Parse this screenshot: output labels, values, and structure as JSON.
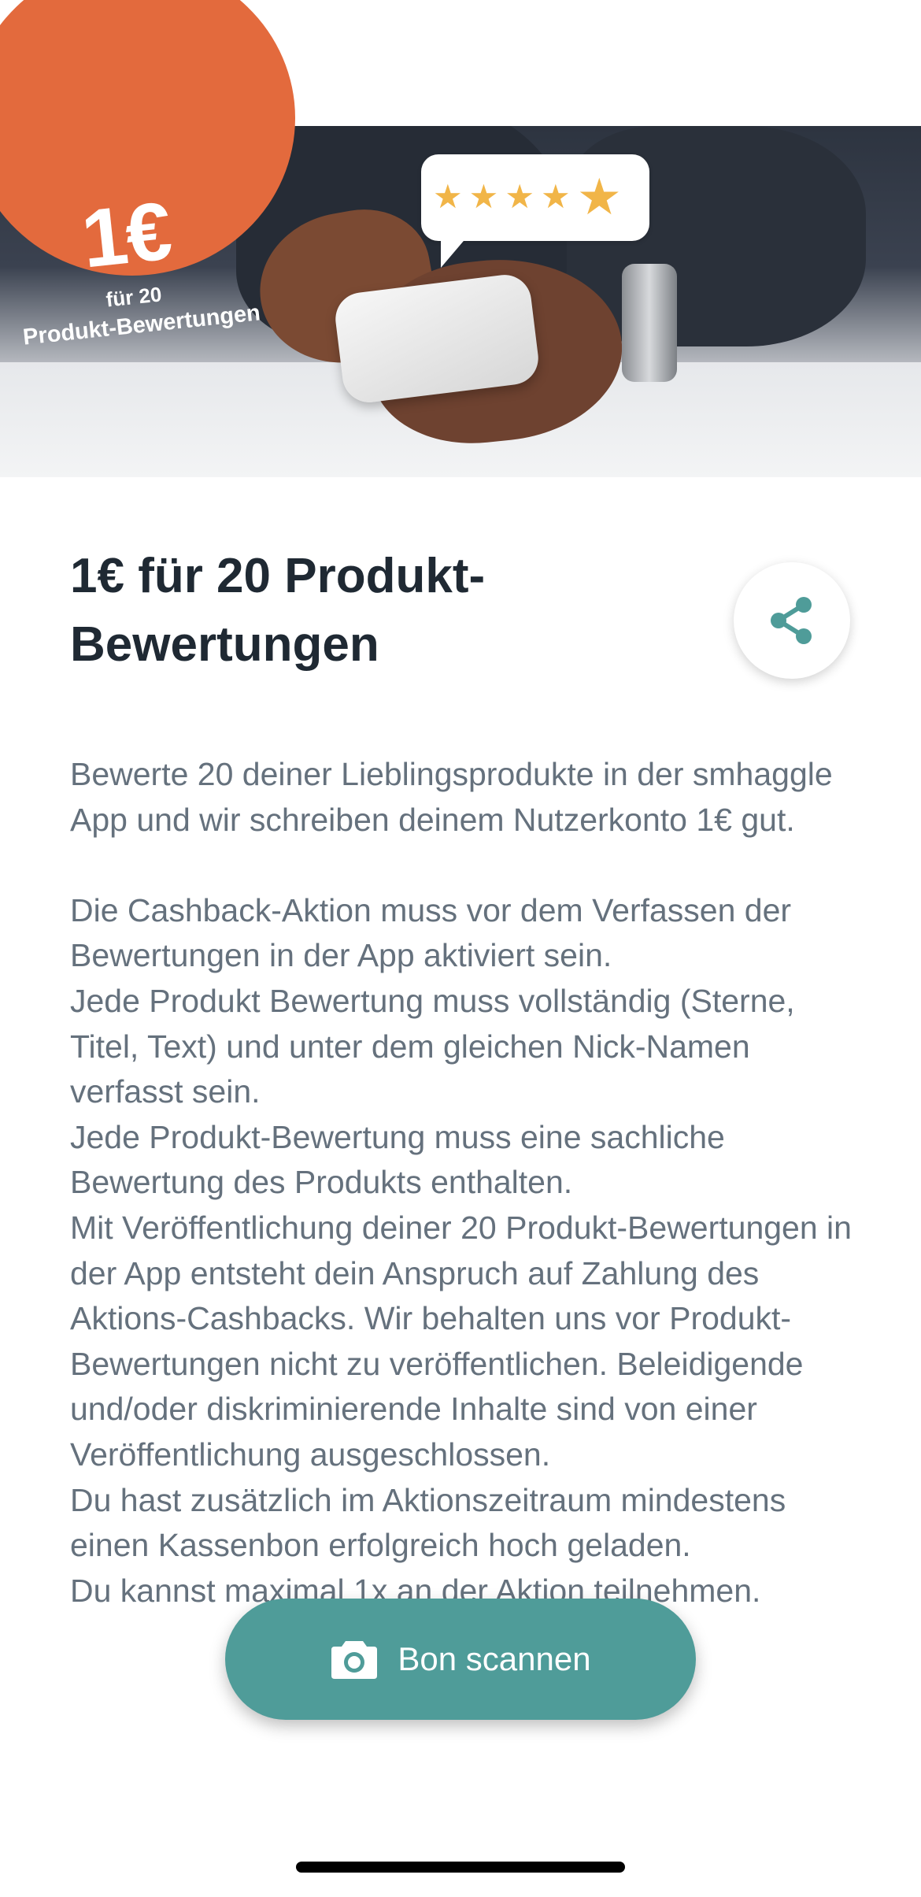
{
  "header": {
    "back_icon": "arrow-left-icon"
  },
  "hero": {
    "badge_amount": "1€",
    "badge_line1": "für 20",
    "badge_line2": "Produkt-Bewertungen",
    "rating_stars": 5
  },
  "offer": {
    "title": "1€ für 20 Produkt-Bewertungen",
    "share_icon": "share-icon",
    "intro": "Bewerte 20 deiner Lieblingsprodukte in der smhaggle App und wir schreiben deinem Nutzerkonto 1€ gut.",
    "conditions": [
      "Die Cashback-Aktion muss vor dem Verfassen der Bewertungen in der App aktiviert sein.",
      "Jede Produkt Bewertung muss vollständig (Sterne, Titel, Text) und unter dem gleichen Nick-Namen verfasst sein.",
      "Jede Produkt-Bewertung muss eine sachliche Bewertung des Produkts enthalten.",
      "Mit Veröffentlichung deiner 20 Produkt-Bewertungen in der App entsteht dein Anspruch auf Zahlung des Aktions-Cashbacks. Wir behalten uns vor Produkt-Bewertungen nicht zu veröffentlichen. Beleidigende und/oder diskriminierende Inhalte sind von einer Veröffentlichung ausgeschlossen.",
      "Du hast zusätzlich im Aktionszeitraum mindestens einen Kassenbon erfolgreich hoch geladen.",
      "Du kannst maximal 1x an der Aktion teilnehmen."
    ]
  },
  "actions": {
    "scan_label": "Bon scannen",
    "scan_icon": "camera-icon"
  },
  "colors": {
    "accent": "#e36a3d",
    "primary": "#4f9c99",
    "title": "#1f2933",
    "body": "#65717d",
    "star": "#f1b548"
  }
}
